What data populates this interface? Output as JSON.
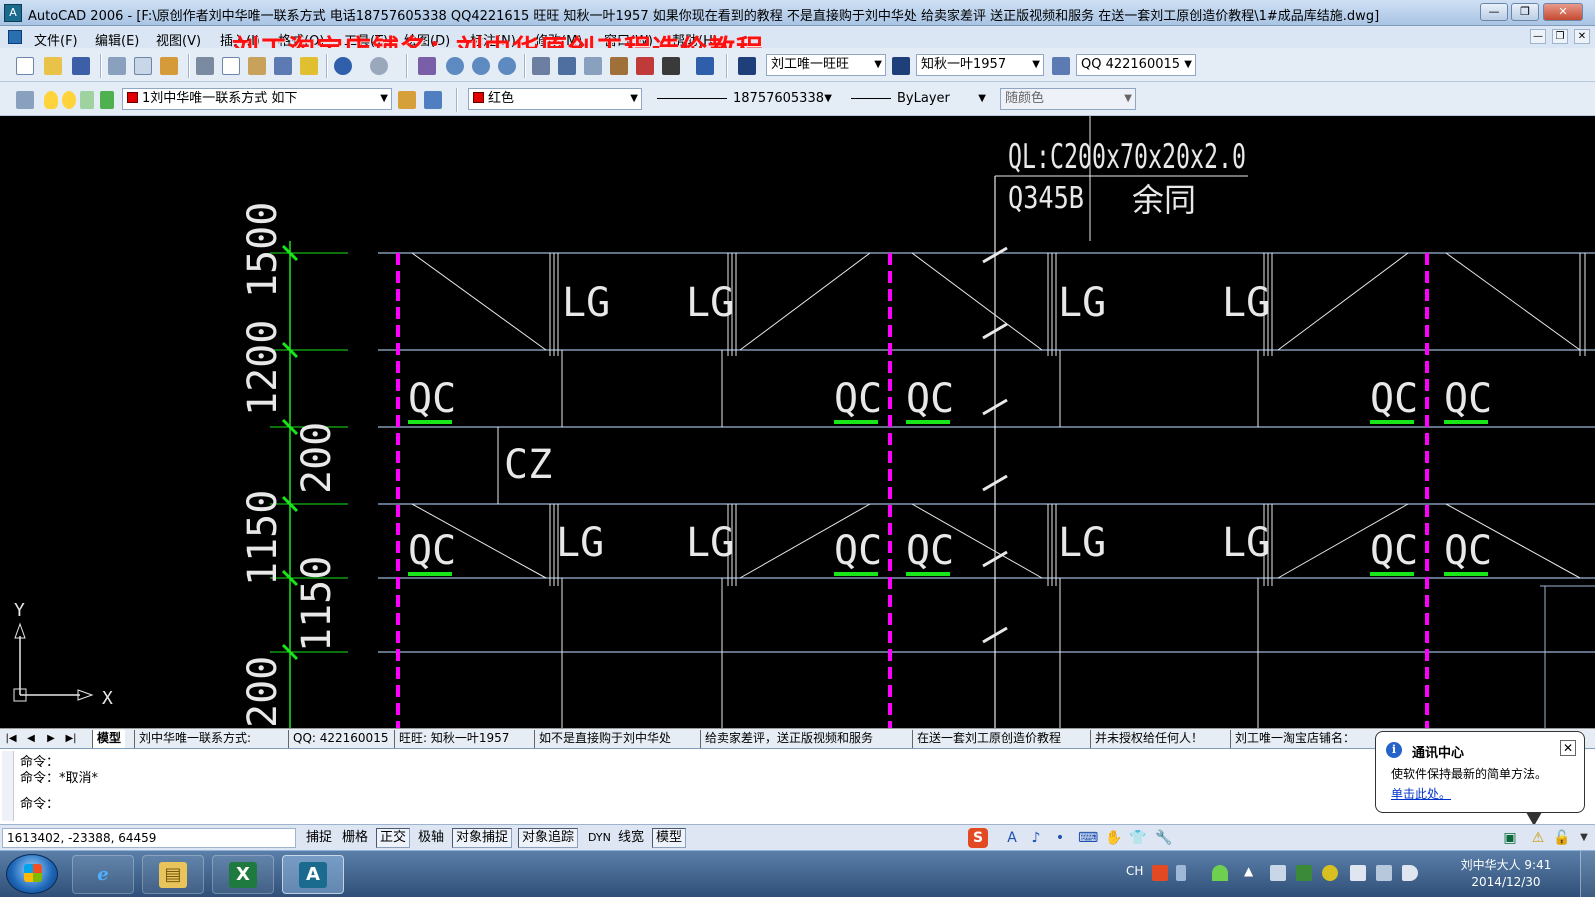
{
  "window": {
    "title": "AutoCAD 2006 - [F:\\原创作者刘中华唯一联系方式 电话18757605338 QQ4221615 旺旺 知秋一叶1957 如果你现在看到的教程 不是直接购于刘中华处 给卖家差评 送正版视频和服务 在送一套刘工原创造价教程\\1#成品库结施.dwg]",
    "app_icon": "A",
    "minimize": "—",
    "maximize": "❐",
    "close": "✕"
  },
  "menu": {
    "items": [
      "文件(F)",
      "编辑(E)",
      "视图(V)",
      "插入(I)",
      "格式(O)",
      "工具(T)",
      "绘图(D)",
      "标注(N)",
      "修改(M)",
      "窗口(W)",
      "帮助(H)"
    ],
    "doc_controls": [
      "—",
      "❐",
      "✕"
    ]
  },
  "watermark": "刘工淘宝店铺名：刘中华原创工程造价教程",
  "toolbar1": {
    "text_style": "刘工唯一旺旺",
    "dim_style": "知秋一叶1957",
    "table_style": "QQ 422160015"
  },
  "toolbar2": {
    "layer": "1刘中华唯一联系方式 如下",
    "color": "红色",
    "linetype": "18757605338",
    "lineweight": "ByLayer",
    "plotstyle": "随颜色"
  },
  "drawing": {
    "beam_label": "QL:C200x70x20x2.0",
    "material": "Q345B",
    "note": "余同",
    "dims": [
      "1500",
      "1200",
      "200",
      "1150",
      "1150",
      "200"
    ],
    "labels": {
      "lg": "LG",
      "qc": "QC",
      "cz": "CZ"
    },
    "ucs": {
      "x": "X",
      "y": "Y"
    }
  },
  "layout_tabs": {
    "nav": [
      "|◀",
      "◀",
      "▶",
      "▶|"
    ],
    "model": "模型",
    "tabs": [
      "刘中华唯一联系方式:",
      "QQ: 422160015",
      "旺旺: 知秋一叶1957",
      "如不是直接购于刘中华处",
      "给卖家差评，送正版视频和服务",
      "在送一套刘工原创造价教程",
      "并未授权给任何人！",
      "刘工唯一淘宝店铺名："
    ]
  },
  "command": {
    "lines": [
      "命令：",
      "命令：*取消*",
      "命令："
    ]
  },
  "balloon": {
    "title": "通讯中心",
    "message": "使软件保持最新的简单方法。",
    "link": "单击此处。",
    "close": "✕",
    "info": "i"
  },
  "status": {
    "coords": "1613402, -23388, 64459",
    "buttons": [
      "捕捉",
      "栅格",
      "正交",
      "极轴",
      "对象捕捉",
      "对象追踪",
      "DYN",
      "线宽",
      "模型"
    ],
    "on_buttons": [
      "正交",
      "对象捕捉",
      "对象追踪",
      "模型"
    ],
    "ime": [
      "S",
      "A",
      "♪",
      "•",
      "⌨",
      "✋",
      "👕",
      "🔧"
    ]
  },
  "taskbar": {
    "lang": "CH",
    "clock_user": "刘中华大人 9:41",
    "clock_date": "2014/12/30",
    "apps": [
      "e",
      "▤",
      "X",
      "A"
    ]
  },
  "colors": {
    "cad_line": "#9cb6d6",
    "cad_white": "#e8e8e8",
    "green": "#19e619",
    "magenta": "#ff00ff"
  }
}
